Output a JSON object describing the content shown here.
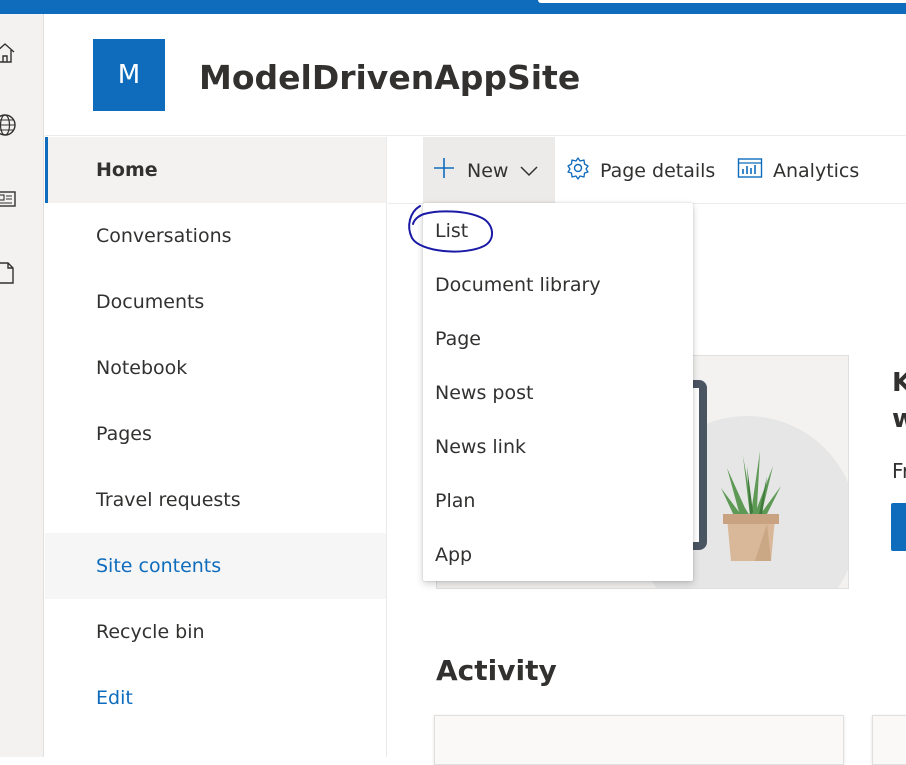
{
  "site": {
    "logo_letter": "M",
    "title": "ModelDrivenAppSite"
  },
  "app_rail": {
    "icons": [
      "home-icon",
      "globe-icon",
      "news-icon",
      "document-icon"
    ]
  },
  "left_nav": {
    "items": [
      {
        "label": "Home",
        "state": "active"
      },
      {
        "label": "Conversations"
      },
      {
        "label": "Documents"
      },
      {
        "label": "Notebook"
      },
      {
        "label": "Pages"
      },
      {
        "label": "Travel requests"
      },
      {
        "label": "Site contents",
        "state": "hover"
      },
      {
        "label": "Recycle bin"
      },
      {
        "label": "Edit",
        "state": "link"
      }
    ]
  },
  "command_bar": {
    "new_label": "New",
    "page_details_label": "Page details",
    "analytics_label": "Analytics"
  },
  "new_menu": {
    "items": [
      "List",
      "Document library",
      "Page",
      "News post",
      "News link",
      "Plan",
      "App"
    ],
    "circled_item": "List",
    "annotation_color": "#1a1aa6"
  },
  "hero_card": {
    "heading_line1_partial": "K",
    "heading_line2_partial": "w",
    "text_partial": "Fr"
  },
  "activity": {
    "title": "Activity"
  },
  "colors": {
    "brand": "#0f6cbd",
    "text": "#323130",
    "nav_active_bg": "#f3f2f1"
  }
}
